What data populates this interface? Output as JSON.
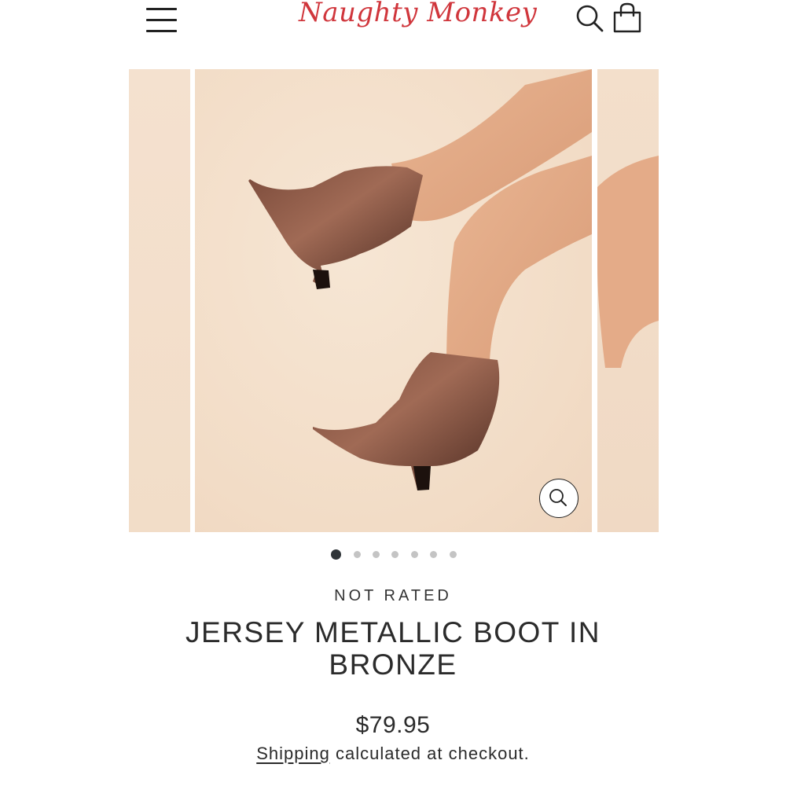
{
  "header": {
    "logo_text": "Naughty Monkey",
    "brand_color": "#d0363c",
    "menu_icon": "hamburger-menu-icon",
    "search_icon": "search-icon",
    "cart_icon": "shopping-bag-icon"
  },
  "gallery": {
    "slide_count": 7,
    "active_slide": 1,
    "zoom_icon": "zoom-magnifier-icon"
  },
  "product": {
    "rating_text": "NOT RATED",
    "title": "JERSEY METALLIC BOOT IN BRONZE",
    "price": "$79.95",
    "shipping_link": "Shipping",
    "shipping_suffix": " calculated at checkout."
  }
}
